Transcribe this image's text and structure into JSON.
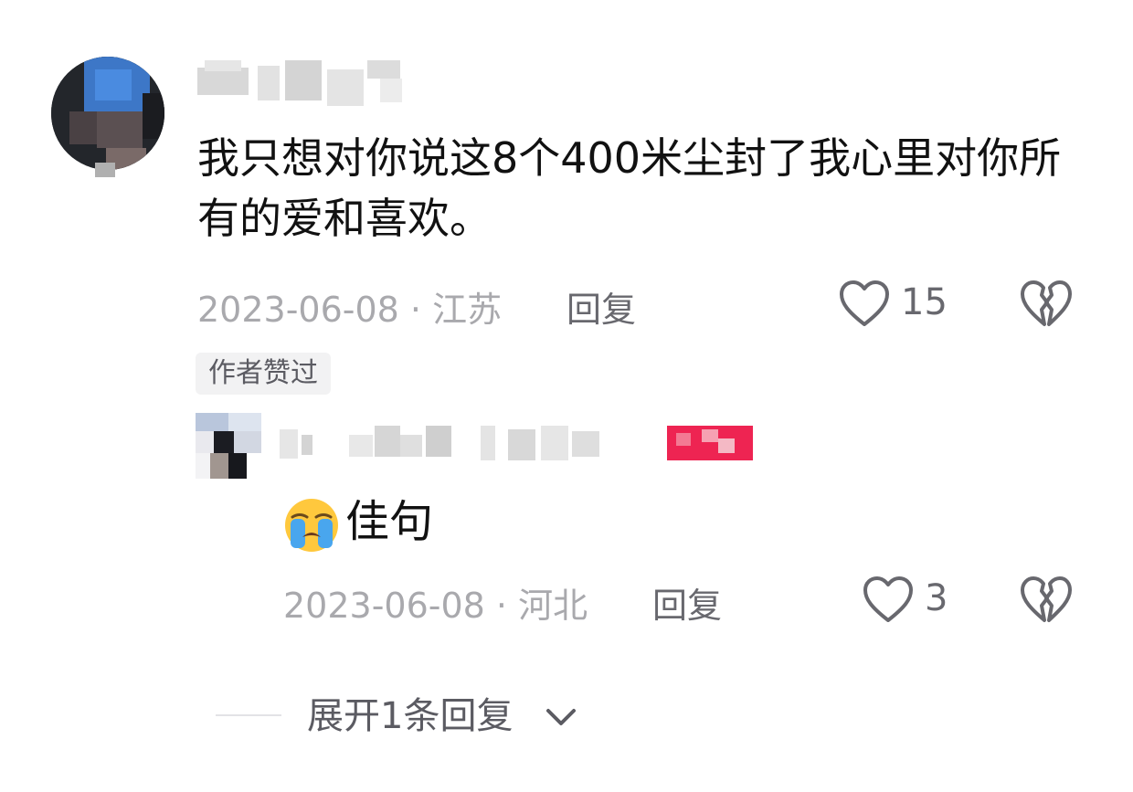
{
  "comment": {
    "author_name": "",
    "text": "我只想对你说这8个400米尘封了我心里对你所有的爱和喜欢。",
    "date_location": "2023-06-08 · 江苏",
    "reply_label": "回复",
    "like_count": "15",
    "author_liked_badge": "作者赞过",
    "icons": {
      "like": "heart-outline-icon",
      "dislike": "broken-heart-icon"
    }
  },
  "reply": {
    "author_name": "",
    "emoji": "loudly-crying-face-emoji",
    "text": "佳句",
    "date_location": "2023-06-08 · 河北",
    "reply_label": "回复",
    "like_count": "3"
  },
  "expand": {
    "label": "展开1条回复",
    "icon": "chevron-down-icon"
  },
  "colors": {
    "text_primary": "#111111",
    "text_meta": "#a9a9ad",
    "text_action": "#68686e",
    "badge_bg": "#f2f2f3",
    "accent_pink": "#ee2452"
  }
}
